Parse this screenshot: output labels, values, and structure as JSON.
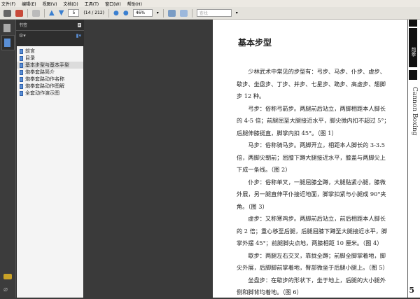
{
  "menu": [
    "文件(F)",
    "编辑(E)",
    "视图(V)",
    "文档(D)",
    "工具(T)",
    "窗口(W)",
    "帮助(H)"
  ],
  "toolbar": {
    "page_current": "5",
    "page_info": "(14 / 212)",
    "zoom": "46%",
    "search_placeholder": "查找"
  },
  "panel": {
    "title": "书签",
    "bookmarks": [
      "前言",
      "目录",
      "基本步型与基本手型",
      "炮拳套路简介",
      "炮拳套路动作名称",
      "炮拳套路动作图解",
      "全套动作演示图"
    ],
    "selected_index": 2
  },
  "page": {
    "heading": "基本步型",
    "paragraphs": [
      "少林武术中常见的步型有：弓步、马步、仆步、虚步、歇步、坐盘步、丁步、并步、七星步、跪步、高虚步、翘脚步 12 种。",
      "弓步：俗称弓箭步。两腿前后站立，两脚相距本人脚长的 4-5 倍；前腿屈至大腿接近水平，脚尖微内扣不超过 5°；后腿伸膝挺直，脚掌内扣 45°。（图 1）",
      "马步：俗称骑马步。两脚开立，相距本人脚长的 3-3.5 倍，两脚尖朝前；屈膝下蹲大腿接近水平，膝盖与两脚尖上下成一条线。（图 2）",
      "仆步：俗称单叉，一腿屈膝全蹲，大腿贴紧小腿，膝微外展，另一腿直伸平仆接近地面，脚掌扣紧与小腿成 90°夹角。（图 3）",
      "虚步：又称寒鸡步。两脚前后站立，前后相距本人脚长的 2 倍；重心移至后腿，后腿屈膝下蹲至大腿接近水平，脚掌外摆 45°；前腿脚尖点地，两膝相距 10 厘米。（图 4）",
      "歇步：两腿左右交叉，靠拢全蹲；前脚全脚掌着地，脚尖外展，后脚脚前掌着地，臀部微坐于后腿小腿上。（图 5）",
      "坐盘步：在歇步的形状下，坐于地上，后腿的大小腿外侧和脚背均着地。（图 6）"
    ],
    "side_title": "炮拳",
    "side_english": "Cannon Boxing",
    "page_number": "5"
  }
}
